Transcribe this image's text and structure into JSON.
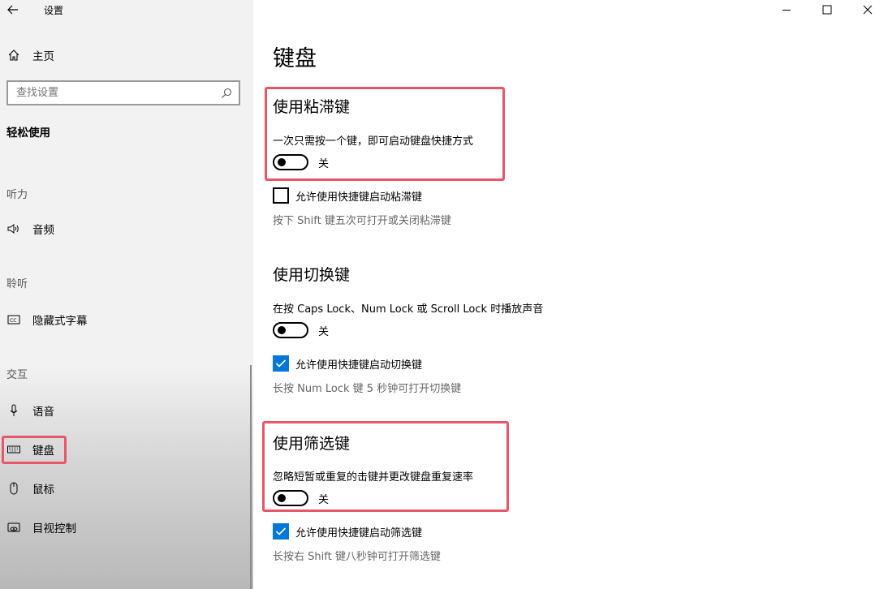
{
  "window": {
    "title": "设置"
  },
  "sidebar": {
    "home_label": "主页",
    "search_placeholder": "查找设置",
    "section_title": "轻松使用",
    "groups": {
      "hearing": "听力",
      "listening": "聆听",
      "interaction": "交互"
    },
    "items": {
      "audio": "音频",
      "captions": "隐藏式字幕",
      "speech": "语音",
      "keyboard": "键盘",
      "mouse": "鼠标",
      "eye_control": "目视控制"
    }
  },
  "main": {
    "page_title": "键盘",
    "sticky": {
      "title": "使用粘滞键",
      "description": "一次只需按一个键，即可启动键盘快捷方式",
      "toggle_state": "关",
      "checkbox_label": "允许使用快捷键启动粘滞键",
      "checkbox_checked": false,
      "hint": "按下 Shift 键五次可打开或关闭粘滞键"
    },
    "toggle_keys": {
      "title": "使用切换键",
      "description": "在按 Caps Lock、Num Lock 或 Scroll Lock 时播放声音",
      "toggle_state": "关",
      "checkbox_label": "允许使用快捷键启动切换键",
      "checkbox_checked": true,
      "hint": "长按 Num Lock 键 5 秒钟可打开切换键"
    },
    "filter_keys": {
      "title": "使用筛选键",
      "description": "忽略短暂或重复的击键并更改键盘重复速率",
      "toggle_state": "关",
      "checkbox_label": "允许使用快捷键启动筛选键",
      "checkbox_checked": true,
      "hint": "长按右 Shift 键八秒钟可打开筛选键"
    }
  },
  "colors": {
    "accent": "#0078d7",
    "highlight": "#e8566a"
  }
}
